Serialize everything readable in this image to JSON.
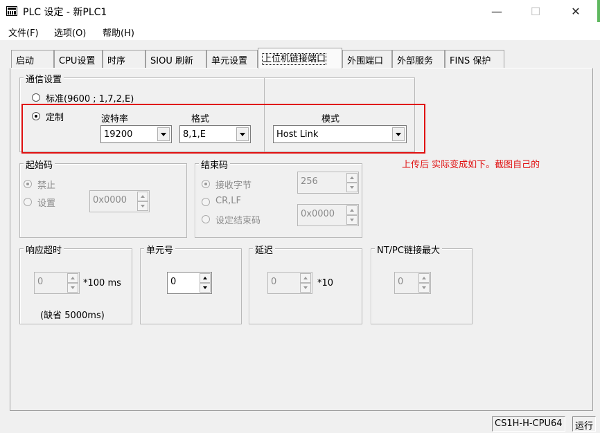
{
  "window": {
    "title": "PLC 设定 - 新PLC1",
    "minimize_glyph": "—",
    "maximize_glyph": "☐",
    "close_glyph": "✕"
  },
  "menu": {
    "file": "文件(F)",
    "options": "选项(O)",
    "help": "帮助(H)"
  },
  "tabs": [
    {
      "label": "启动"
    },
    {
      "label": "CPU设置"
    },
    {
      "label": "时序"
    },
    {
      "label": "SIOU 刷新"
    },
    {
      "label": "单元设置"
    },
    {
      "label": "上位机链接端口",
      "active": true
    },
    {
      "label": "外围端口"
    },
    {
      "label": "外部服务"
    },
    {
      "label": "FINS 保护"
    }
  ],
  "comm": {
    "group_title": "通信设置",
    "standard_label": "标准(9600 ; 1,7,2,E)",
    "custom_label": "定制",
    "selected": "custom",
    "baud_label": "波特率",
    "baud_value": "19200",
    "format_label": "格式",
    "format_value": "8,1,E",
    "mode_label": "模式",
    "mode_value": "Host Link"
  },
  "annotation_note": "上传后  实际变成如下。截图自己的",
  "start_code": {
    "group_title": "起始码",
    "disable_label": "禁止",
    "set_label": "设置",
    "selected": "disable",
    "value": "0x0000"
  },
  "end_code": {
    "group_title": "结束码",
    "receive_bytes_label": "接收字节",
    "crlf_label": "CR,LF",
    "set_end_label": "设定结束码",
    "selected": "receive_bytes",
    "bytes_value": "256",
    "code_value": "0x0000"
  },
  "response_timeout": {
    "group_title": "响应超时",
    "value": "0",
    "unit": "*100 ms",
    "default_note": "(缺省 5000ms)"
  },
  "unit_no": {
    "group_title": "单元号",
    "value": "0"
  },
  "delay": {
    "group_title": "延迟",
    "value": "0",
    "unit": "*10"
  },
  "ntpc": {
    "group_title": "NT/PC链接最大",
    "value": "0"
  },
  "status": {
    "model": "CS1H-H-CPU64",
    "mode": "运行"
  },
  "colors": {
    "annotation_red": "#e01010",
    "window_bg": "#f0f0f0"
  }
}
